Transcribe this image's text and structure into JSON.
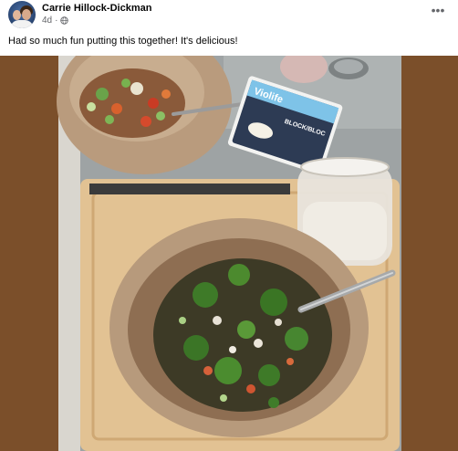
{
  "post": {
    "author": "Carrie Hillock-Dickman",
    "time": "4d",
    "privacy_icon": "globe-icon",
    "more_icon": "more-options-icon",
    "caption": "Had so much fun putting this together! It's delicious!"
  },
  "photo": {
    "package_brand": "Violife",
    "package_label": "BLOCK/BLOC"
  },
  "colors": {
    "frame": "#7b4f2a",
    "counter": "#9aa0a2",
    "board": "#e6c79a",
    "bowl": "#b99b7d"
  }
}
